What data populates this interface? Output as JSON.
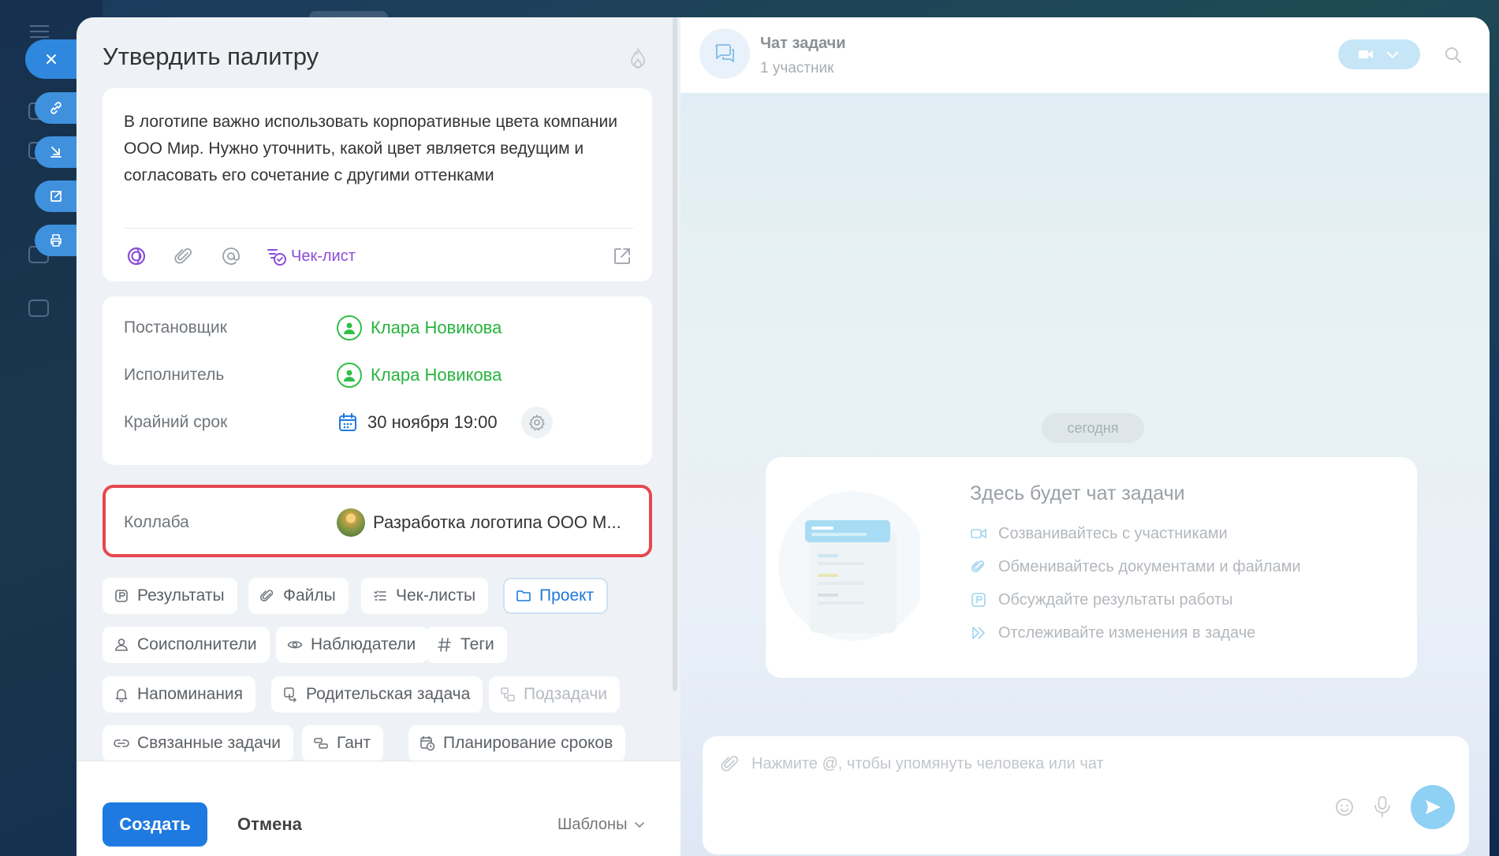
{
  "task": {
    "title": "Утвердить палитру",
    "description": "В логотипе важно использовать корпоративные цвета компании ООО Мир. Нужно уточнить, какой цвет является ведущим и согласовать его сочетание с другими оттенками",
    "checklist_link": "Чек-лист"
  },
  "fields": {
    "creator_label": "Постановщик",
    "creator_name": "Клара Новикова",
    "assignee_label": "Исполнитель",
    "assignee_name": "Клара Новикова",
    "deadline_label": "Крайний срок",
    "deadline_value": "30 ноября 19:00",
    "collab_label": "Коллаба",
    "collab_value": "Разработка логотипа ООО М..."
  },
  "chips": [
    {
      "label": "Результаты",
      "icon": "results-icon",
      "state": "normal"
    },
    {
      "label": "Файлы",
      "icon": "paperclip-icon",
      "state": "normal"
    },
    {
      "label": "Чек-листы",
      "icon": "checklist-icon",
      "state": "normal"
    },
    {
      "label": "Проект",
      "icon": "folder-icon",
      "state": "active"
    },
    {
      "label": "Соисполнители",
      "icon": "person-icon",
      "state": "normal"
    },
    {
      "label": "Наблюдатели",
      "icon": "eye-icon",
      "state": "normal"
    },
    {
      "label": "Теги",
      "icon": "hash-icon",
      "state": "normal"
    },
    {
      "label": "Напоминания",
      "icon": "bell-icon",
      "state": "normal"
    },
    {
      "label": "Родительская задача",
      "icon": "parent-task-icon",
      "state": "normal"
    },
    {
      "label": "Подзадачи",
      "icon": "subtasks-icon",
      "state": "disabled"
    },
    {
      "label": "Связанные задачи",
      "icon": "link-icon",
      "state": "normal"
    },
    {
      "label": "Гант",
      "icon": "gantt-icon",
      "state": "normal"
    },
    {
      "label": "Планирование сроков",
      "icon": "calendar-clock-icon",
      "state": "normal"
    }
  ],
  "footer": {
    "create": "Создать",
    "cancel": "Отмена",
    "templates": "Шаблоны"
  },
  "chat": {
    "title": "Чат задачи",
    "subtitle": "1 участник",
    "today": "сегодня",
    "empty_title": "Здесь будет чат задачи",
    "empty_items": [
      "Созванивайтесь с участниками",
      "Обменивайтесь документами и файлами",
      "Обсуждайте результаты работы",
      "Отслеживайте изменения в задаче"
    ],
    "input_placeholder": "Нажмите @, чтобы упомянуть человека или чат"
  },
  "colors": {
    "accent": "#1e7ae1",
    "person": "#27b43e",
    "highlight": "#e5484f",
    "checklist": "#8c4cd6"
  }
}
